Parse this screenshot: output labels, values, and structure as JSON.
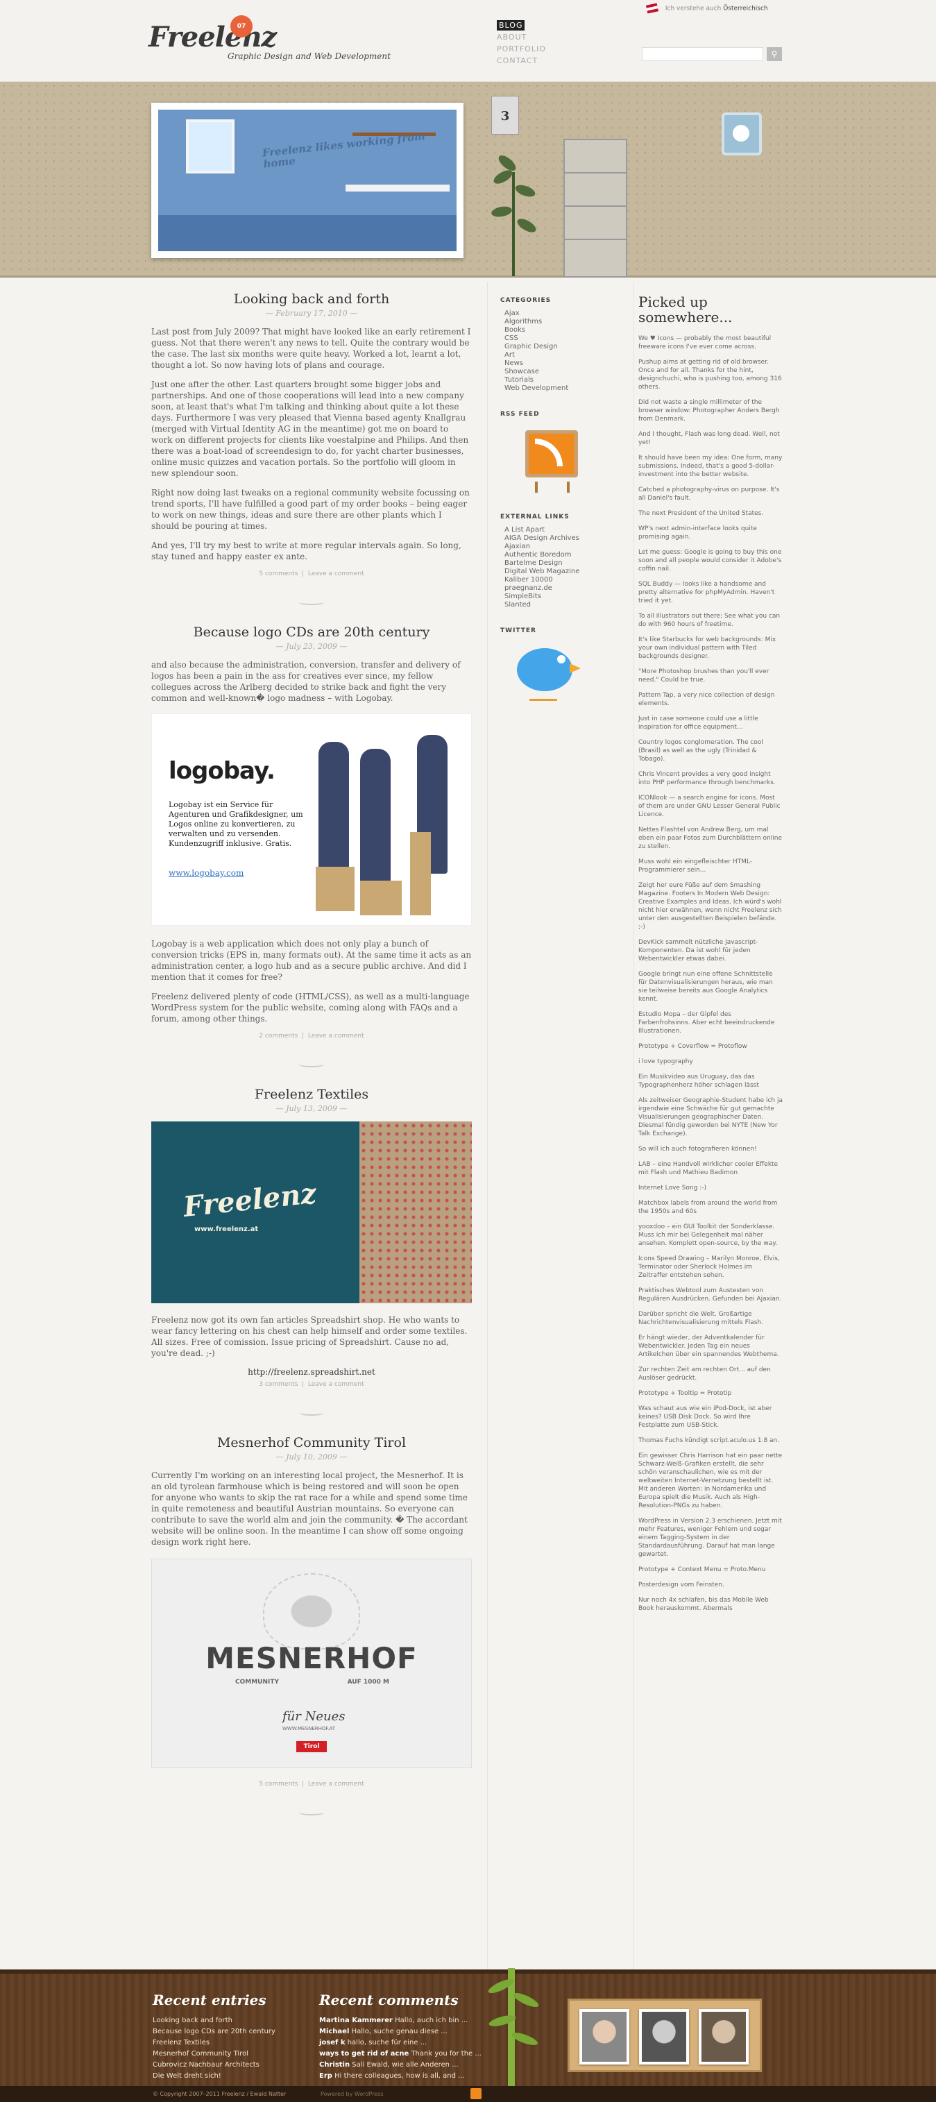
{
  "header": {
    "logo_text": "Freelenz",
    "logo_badge": "07",
    "tagline": "Graphic Design and Web Development",
    "nav": [
      "Blog",
      "About",
      "Portfolio",
      "Contact"
    ],
    "lang_text": "Ich verstehe auch",
    "lang_bold": "Österreichisch",
    "search_placeholder": "",
    "search_button": "⚲"
  },
  "hero": {
    "text": "Freelenz likes working from home",
    "calendar_day": "3"
  },
  "posts": [
    {
      "title": "Looking back and forth",
      "date": "— February 17, 2010 —",
      "paragraphs": [
        "Last post from July 2009? That might have looked like an early retirement I guess. Not that there weren't any news to tell. Quite the contrary would be the case. The last six months were quite heavy. Worked a lot, learnt a lot, thought a lot. So now having lots of plans and courage.",
        "Just one after the other. Last quarters brought some bigger jobs and partnerships. And one of those cooperations will lead into a new company soon, at least that's what I'm talking and thinking about quite a lot these days. Furthermore I was very pleased that Vienna based agenty Knallgrau (merged with Virtual Identity AG in the meantime) got me on board to work on different projects for clients like voestalpine and Philips. And then there was a boat-load of screendesign to do, for yacht charter businesses, online music quizzes and vacation portals. So the portfolio will gloom in new splendour soon.",
        "Right now doing last tweaks on a regional community website focussing on trend sports, I'll have fulfilled a good part of my order books – being eager to work on new things, ideas and sure there are other plants which I should be pouring at times.",
        "And yes, I'll try my best to write at more regular intervals again. So long, stay tuned and happy easter ex ante."
      ],
      "comments": "5 comments",
      "leave": "Leave a comment"
    },
    {
      "title": "Because logo CDs are 20th century",
      "date": "— July 23, 2009 —",
      "paragraphs": [
        "and also because the administration, conversion, transfer and delivery of logos has been a pain in the ass for creatives ever since, my fellow collegues across the Arlberg decided to strike back and fight the very common and well-known� logo madness – with Logobay.",
        "Logobay is a web application which does not only play a bunch of conversion tricks (EPS in, many formats out). At the same time it acts as an administration center, a logo hub and as a secure public archive. And did I mention that it comes for free?",
        "Freelenz delivered plenty of code (HTML/CSS), as well as a multi-language WordPress system for the public website, coming along with FAQs and a forum, among other things."
      ],
      "comments": "2 comments",
      "leave": "Leave a comment",
      "image": {
        "brand": "logobay.",
        "desc": "Logobay ist ein Service für Agenturen und Grafikdesigner, um Logos online zu konvertieren, zu verwalten und zu versenden. Kundenzugriff inklusive. Gratis.",
        "url": "www.logobay.com"
      }
    },
    {
      "title": "Freelenz Textiles",
      "date": "— July 13, 2009 —",
      "paragraphs": [
        "Freelenz now got its own fan articles Spreadshirt shop. He who wants to wear fancy lettering on his chest can help himself and order some textiles. All sizes. Free of comission. Issue pricing of Spreadshirt. Cause no ad, you're dead. ;-)"
      ],
      "url": "http://freelenz.spreadshirt.net",
      "comments": "3 comments",
      "leave": "Leave a comment",
      "image": {
        "logo": "Freelenz",
        "url": "www.freelenz.at"
      }
    },
    {
      "title": "Mesnerhof Community Tirol",
      "date": "— July 10, 2009 —",
      "paragraphs": [
        "Currently I'm working on an interesting local project, the Mesnerhof. It is an old tyrolean farmhouse which is being restored and will soon be open for anyone who wants to skip the rat race for a while and spend some time in quite remoteness and beautiful Austrian mountains. So everyone can contribute to save the world alm and join the community. � The accordant website will be online soon. In the meantime I can show off some ongoing design work right here."
      ],
      "comments": "5 comments",
      "leave": "Leave a comment",
      "image": {
        "name": "MESNERHOF",
        "sub1": "COMMUNITY",
        "sub2": "AUF 1000 M",
        "fn": "für Neues",
        "fn2": "WWW.MESNERHOF.AT",
        "tirol": "Tirol"
      }
    }
  ],
  "sidebar": {
    "categories_title": "Categories",
    "categories": [
      "Ajax",
      "Algorithms",
      "Books",
      "CSS",
      "Graphic Design",
      "Art",
      "News",
      "Showcase",
      "Tutorials",
      "Web Development"
    ],
    "rss_title": "RSS Feed",
    "links_title": "External Links",
    "links": [
      "A List Apart",
      "AIGA Design Archives",
      "Ajaxian",
      "Authentic Boredom",
      "Bartelme Design",
      "Digital Web Magazine",
      "Kaliber 10000",
      "praegnanz.de",
      "SimpleBits",
      "Slanted"
    ],
    "twitter_title": "Twitter"
  },
  "picked": {
    "title": "Picked up somewhere...",
    "items": [
      "We ♥ Icons — probably the most beautiful freeware icons I've ever come across.",
      "Pushup aims at getting rid of old browser. Once and for all. Thanks for the hint, designchuchi, who is pushing too, among 316 others.",
      "Did not waste a single millimeter of the browser window: Photographer Anders Bergh from Denmark.",
      "And I thought, Flash was long dead. Well, not yet!",
      "It should have been my idea: One form, many submissions. Indeed, that's a good 5-dollar-investment into the better website.",
      "Catched a photography-virus on purpose. It's all Daniel's fault.",
      "The next President of the United States.",
      "WP's next admin-interface looks quite promising again.",
      "Let me guess: Google is going to buy this one soon and all people would consider it Adobe's coffin nail.",
      "SQL Buddy — looks like a handsome and pretty alternative for phpMyAdmin. Haven't tried it yet.",
      "To all illustrators out there: See what you can do with 960 hours of freetime.",
      "It's like Starbucks for web backgrounds: Mix your own individual pattern with Tiled backgrounds designer.",
      "\"More Photoshop brushes than you'll ever need.\" Could be true.",
      "Pattern Tap, a very nice collection of design elements.",
      "Just in case someone could use a little inspiration for office equipment...",
      "Country logos conglomeration. The cool (Brasil) as well as the ugly (Trinidad & Tobago).",
      "Chris Vincent provides a very good insight into PHP performance through benchmarks.",
      "ICONlook — a search engine for icons. Most of them are under GNU Lesser General Public Licence.",
      "Nettes Flashtel von Andrew Berg, um mal eben ein paar Fotos zum Durchblättern online zu stellen.",
      "Muss wohl ein eingefleischter HTML-Programmierer sein...",
      "Zeigt her eure Füße auf dem Smashing Magazine. Footers In Modern Web Design: Creative Examples and Ideas. Ich würd's wohl nicht hier erwähnen, wenn nicht Freelenz sich unter den ausgestellten Beispielen befände. ;-)",
      "DevKick sammelt nützliche Javascript-Komponenten. Da ist wohl für jeden Webentwickler etwas dabei.",
      "Google bringt nun eine offene Schnittstelle für Datenvisualisierungen heraus, wie man sie teilweise bereits aus Google Analytics kennt.",
      "Estudio Mopa – der Gipfel des Farbenfrohsinns. Aber echt beeindruckende Illustrationen.",
      "Prototype + Coverflow = Protoflow",
      "i love typography",
      "Ein Musikvideo aus Uruguay, das das Typographenherz höher schlagen lässt",
      "Als zeitweiser Geographie-Student habe ich ja irgendwie eine Schwäche für gut gemachte Visualisierungen geographischer Daten. Diesmal fündig geworden bei NYTE (New Yor Talk Exchange).",
      "So will ich auch fotografieren können!",
      "LAB – eine Handvoll wirklicher cooler Effekte mit Flash und Mathieu Badimon",
      "Internet Love Song :-)",
      "Matchbox labels from around the world from the 1950s and 60s",
      "yooxdoo – ein GUI Toolkit der Sonderklasse. Muss ich mir bei Gelegenheit mal näher ansehen. Komplett open-source, by the way.",
      "Icons Speed Drawing – Marilyn Monroe, Elvis, Terminator oder Sherlock Holmes im Zeitraffer entstehen sehen.",
      "Praktisches Webtool zum Austesten von Regulären Ausdrücken. Gefunden bei Ajaxian.",
      "Darüber spricht die Welt. Großartige Nachrichtenvisualisierung mittels Flash.",
      "Er hängt wieder, der Adventkalender für Webentwickler. Jeden Tag ein neues Artikelchen über ein spannendes Webthema.",
      "Zur rechten Zeit am rechten Ort... auf den Auslöser gedrückt.",
      "Prototype + Tooltip = Prototip",
      "Was schaut aus wie ein iPod-Dock, ist aber keines? USB Disk Dock. So wird Ihre Festplatte zum USB-Stick.",
      "Thomas Fuchs kündigt script.aculo.us 1.8 an.",
      "Ein gewisser Chris Harrison hat ein paar nette Schwarz-Weiß-Grafiken erstellt, die sehr schön veranschaulichen, wie es mit der weltweiten Internet-Vernetzung bestellt ist. Mit anderen Worten: in Nordamerika und Europa spielt die Musik. Auch als High-Resolution-PNGs zu haben.",
      "WordPress in Version 2.3 erschienen. Jetzt mit mehr Features, weniger Fehlern und sogar einem Tagging-System in der Standardausführung. Darauf hat man lange gewartet.",
      "Prototype + Context Menu = Proto.Menu",
      "Posterdesign vom Feinsten.",
      "Nur noch 4x schlafen, bis das Mobile Web Book herauskommt. Abermals"
    ]
  },
  "footer": {
    "recent_entries_title": "Recent entries",
    "recent_entries": [
      "Looking back and forth",
      "Because logo CDs are 20th century",
      "Freelenz Textiles",
      "Mesnerhof Community Tirol",
      "Cubrovicz Nachbaur Architects",
      "Die Welt dreht sich!"
    ],
    "recent_comments_title": "Recent comments",
    "recent_comments": [
      {
        "name": "Martina Kammerer",
        "text": "Hallo, auch ich bin ..."
      },
      {
        "name": "Michael",
        "text": "Hallo, suche genau diese ..."
      },
      {
        "name": "josef k",
        "text": "hallo, suche für eine ..."
      },
      {
        "name": "ways to get rid of acne",
        "text": "Thank you for the ..."
      },
      {
        "name": "Christin",
        "text": "Sali Ewald, wie alle Anderen ..."
      },
      {
        "name": "Erp",
        "text": "Hi there colleagues, how is all, and ..."
      }
    ],
    "copyright": "© Copyright 2007–2011 Freelenz / Ewald Natter",
    "powered": "Powered by WordPress"
  },
  "colors": {
    "background": "#f4f3f0",
    "hero": "#c5b89d",
    "footer": "#5c3c22",
    "rss": "#f08a1c",
    "twitter": "#44a6e8"
  }
}
